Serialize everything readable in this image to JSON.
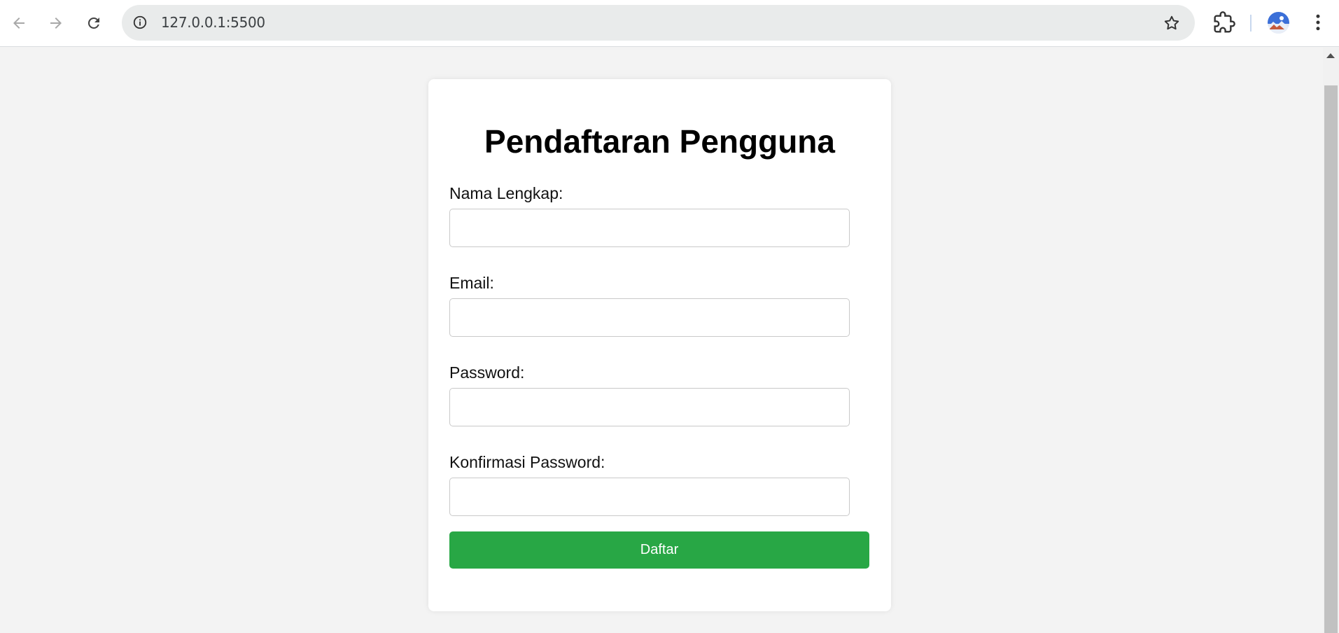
{
  "browser": {
    "url": "127.0.0.1:5500",
    "icons": {
      "back": "arrow-left-icon",
      "forward": "arrow-right-icon",
      "reload": "reload-icon",
      "site_info": "info-icon",
      "bookmark": "star-icon",
      "extensions": "puzzle-icon",
      "profile": "avatar",
      "menu": "kebab-menu-icon"
    }
  },
  "form": {
    "title": "Pendaftaran Pengguna",
    "fields": [
      {
        "label": "Nama Lengkap:",
        "value": "",
        "type": "text"
      },
      {
        "label": "Email:",
        "value": "",
        "type": "email"
      },
      {
        "label": "Password:",
        "value": "",
        "type": "password"
      },
      {
        "label": "Konfirmasi Password:",
        "value": "",
        "type": "password"
      }
    ],
    "submit_label": "Daftar"
  },
  "colors": {
    "page_background": "#f3f3f3",
    "card_background": "#ffffff",
    "submit_button": "#28a745",
    "omnibox": "#e9ebeb"
  }
}
